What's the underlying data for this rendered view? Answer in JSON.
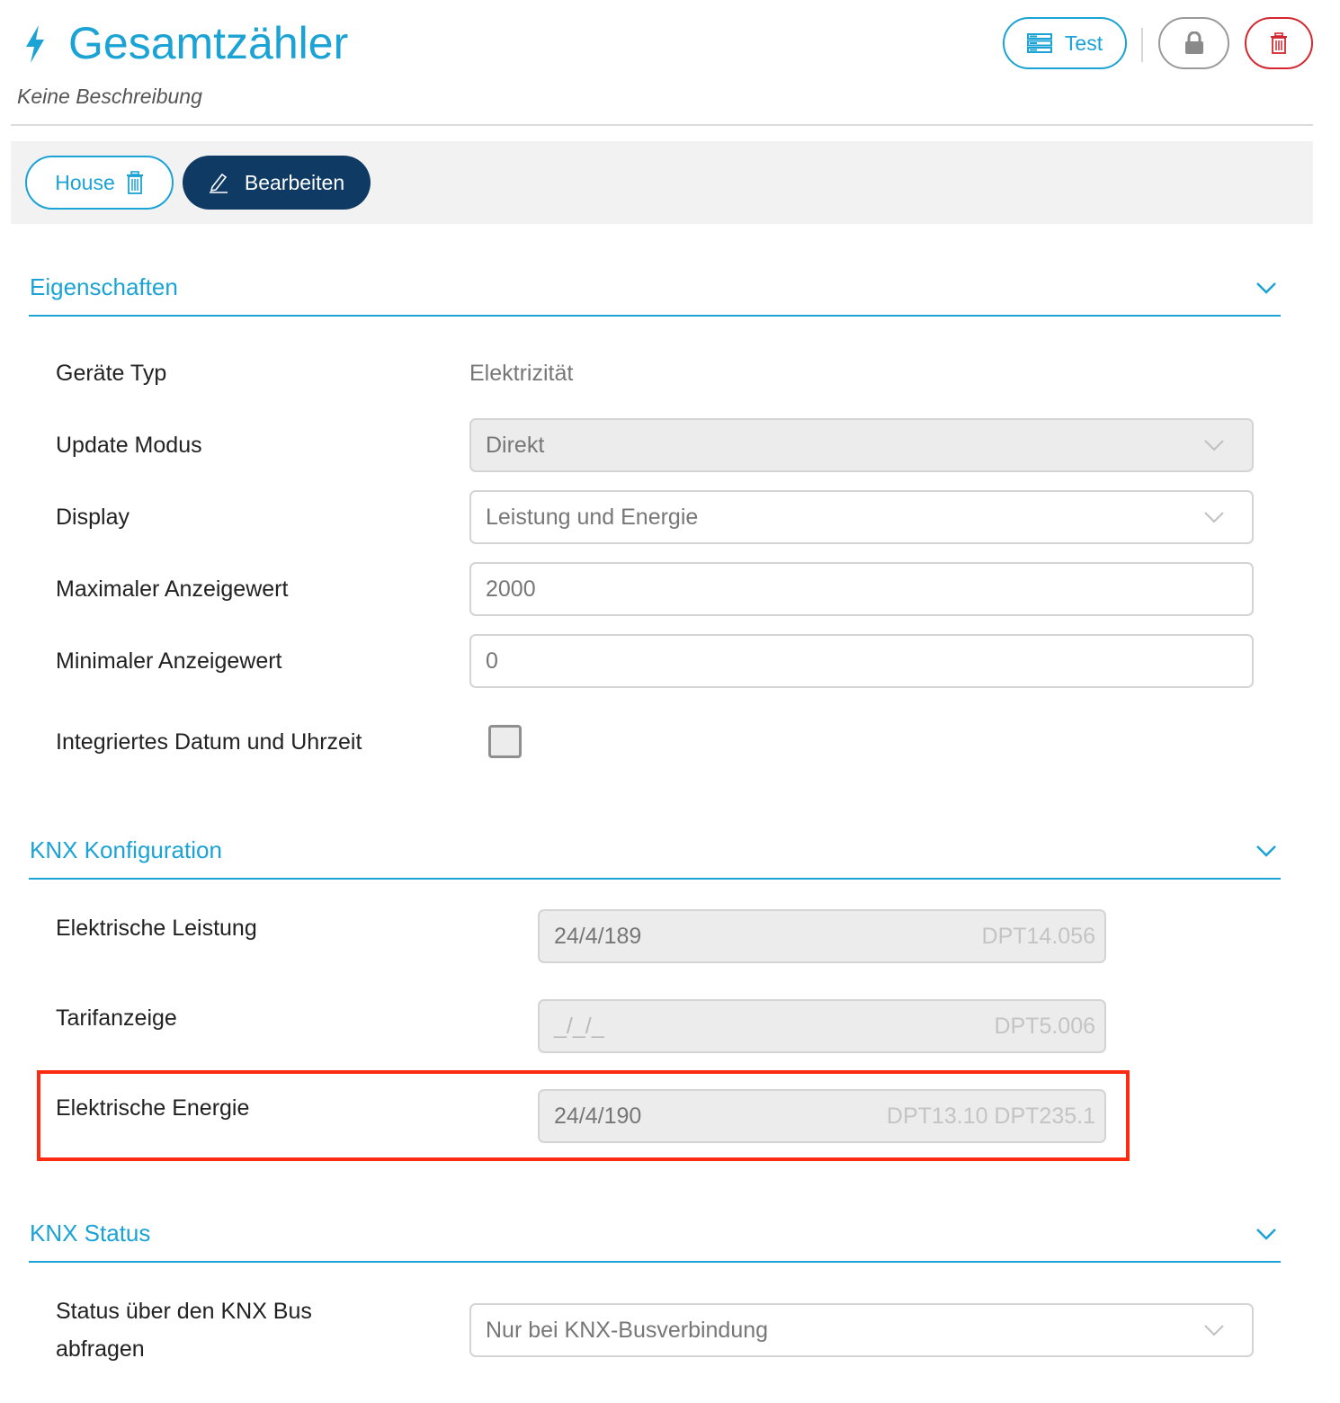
{
  "header": {
    "title": "Gesamtzähler",
    "description": "Keine Beschreibung",
    "test_label": "Test",
    "icons": {
      "title": "bolt-icon",
      "test": "server-list-icon",
      "lock": "lock-icon",
      "delete": "trash-icon"
    }
  },
  "toolbar": {
    "room_chip_label": "House",
    "edit_label": "Bearbeiten"
  },
  "sections": {
    "properties": {
      "title": "Eigenschaften",
      "device_type_label": "Geräte Typ",
      "device_type_value": "Elektrizität",
      "update_mode_label": "Update Modus",
      "update_mode_value": "Direkt",
      "display_label": "Display",
      "display_value": "Leistung und Energie",
      "max_value_label": "Maximaler Anzeigewert",
      "max_value": "2000",
      "min_value_label": "Minimaler Anzeigewert",
      "min_value": "0",
      "datetime_label": "Integriertes Datum und Uhrzeit",
      "datetime_checked": false
    },
    "knx_config": {
      "title": "KNX Konfiguration",
      "power_label": "Elektrische Leistung",
      "power_address": "24/4/189",
      "power_dpt": "DPT14.056",
      "tariff_label": "Tarifanzeige",
      "tariff_address": "_/_/_",
      "tariff_dpt": "DPT5.006",
      "energy_label": "Elektrische Energie",
      "energy_address": "24/4/190",
      "energy_dpt": "DPT13.10 DPT235.1"
    },
    "knx_status": {
      "title": "KNX Status",
      "query_label_line1": "Status über den KNX Bus",
      "query_label_line2": "abfragen",
      "query_value": "Nur bei KNX-Busverbindung"
    }
  },
  "colors": {
    "accent": "#1aa3d4",
    "primary_dark": "#0e3a64",
    "danger": "#d3262e",
    "highlight": "#ff2b10"
  }
}
